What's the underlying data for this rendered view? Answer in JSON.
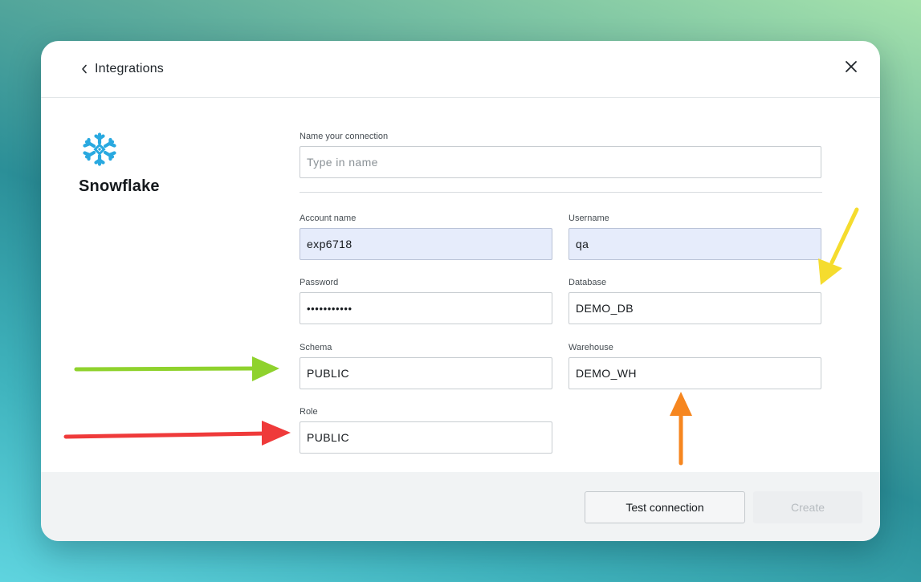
{
  "header": {
    "back_label": "Integrations"
  },
  "brand": {
    "name": "Snowflake",
    "logo_color": "#29a9e0"
  },
  "form": {
    "connection_name": {
      "label": "Name your connection",
      "value": "",
      "placeholder": "Type in name"
    },
    "account_name": {
      "label": "Account name",
      "value": "exp6718"
    },
    "username": {
      "label": "Username",
      "value": "qa"
    },
    "password": {
      "label": "Password",
      "value": "•••••••••••"
    },
    "database": {
      "label": "Database",
      "value": "DEMO_DB"
    },
    "schema": {
      "label": "Schema",
      "value": "PUBLIC"
    },
    "warehouse": {
      "label": "Warehouse",
      "value": "DEMO_WH"
    },
    "role": {
      "label": "Role",
      "value": "PUBLIC"
    }
  },
  "footer": {
    "test_label": "Test connection",
    "create_label": "Create"
  },
  "annotation_colors": {
    "green": "#8fd22d",
    "red": "#ef3a3a",
    "yellow": "#f5dc2e",
    "orange": "#f6861f"
  },
  "icons": [
    "chevron-left-icon",
    "close-icon",
    "snowflake-logo-icon"
  ]
}
